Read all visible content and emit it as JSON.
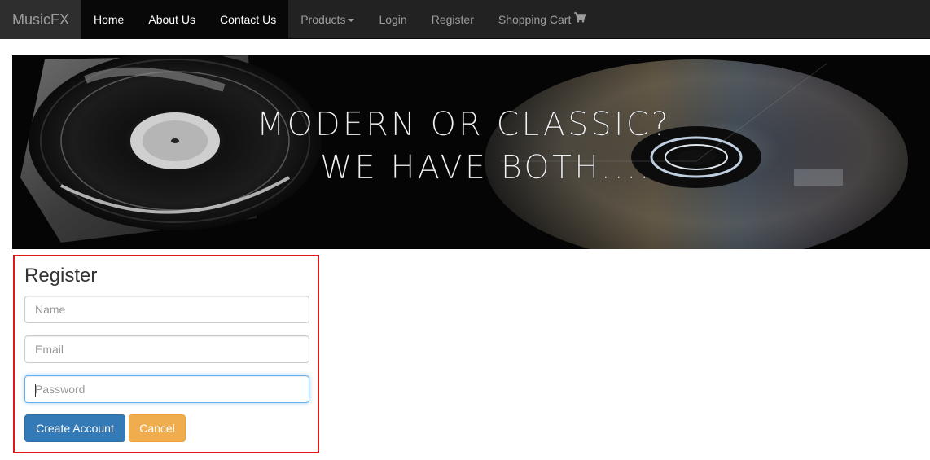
{
  "navbar": {
    "brand": "MusicFX",
    "items": [
      {
        "label": "Home",
        "active": true
      },
      {
        "label": "About Us",
        "active": true
      },
      {
        "label": "Contact Us",
        "active": true
      },
      {
        "label": "Products",
        "active": false,
        "dropdown": true
      },
      {
        "label": "Login",
        "active": false
      },
      {
        "label": "Register",
        "active": false
      },
      {
        "label": "Shopping Cart",
        "active": false,
        "icon": "shopping-cart-icon"
      }
    ]
  },
  "banner": {
    "line1": "MODERN OR CLASSIC?",
    "line2": "WE HAVE BOTH...."
  },
  "register": {
    "title": "Register",
    "name_placeholder": "Name",
    "name_value": "",
    "email_placeholder": "Email",
    "email_value": "",
    "password_placeholder": "Password",
    "password_value": "",
    "create_label": "Create Account",
    "cancel_label": "Cancel"
  },
  "colors": {
    "navbar_bg": "#222222",
    "primary": "#337ab7",
    "warning": "#f0ad4e",
    "highlight_border": "#e3161a"
  }
}
